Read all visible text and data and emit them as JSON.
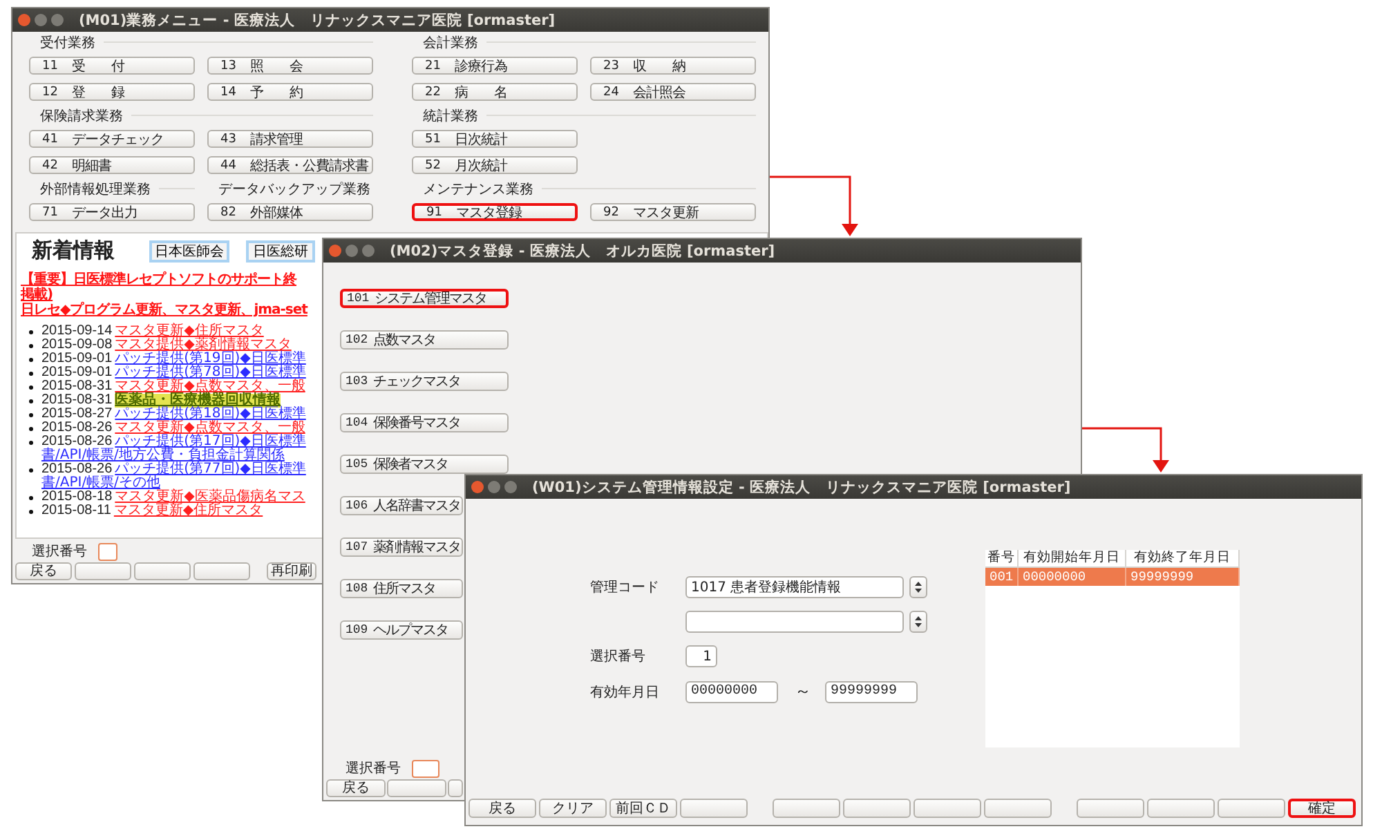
{
  "menu_window": {
    "title": "(M01)業務メニュー - 医療法人　リナックスマニア医院  [ormaster]",
    "rows": [
      {
        "kind": "headers",
        "slots": [
          "受付業務",
          "会計業務"
        ]
      },
      {
        "kind": "buttons",
        "slots": [
          {
            "number": "11",
            "label": "受　　付",
            "highlighted": false
          },
          {
            "number": "13",
            "label": "照　　会",
            "highlighted": false
          },
          {
            "number": "21",
            "label": "診療行為",
            "highlighted": false
          },
          {
            "number": "23",
            "label": "収　　納",
            "highlighted": false
          }
        ]
      },
      {
        "kind": "buttons",
        "slots": [
          {
            "number": "12",
            "label": "登　　録",
            "highlighted": false
          },
          {
            "number": "14",
            "label": "予　　約",
            "highlighted": false
          },
          {
            "number": "22",
            "label": "病　　名",
            "highlighted": false
          },
          {
            "number": "24",
            "label": "会計照会",
            "highlighted": false
          }
        ]
      },
      {
        "kind": "headers",
        "slots": [
          "保険請求業務",
          "統計業務"
        ]
      },
      {
        "kind": "buttons",
        "slots": [
          {
            "number": "41",
            "label": "データチェック",
            "highlighted": false
          },
          {
            "number": "43",
            "label": "請求管理",
            "highlighted": false
          },
          {
            "number": "51",
            "label": "日次統計",
            "highlighted": false
          }
        ]
      },
      {
        "kind": "buttons",
        "slots": [
          {
            "number": "42",
            "label": "明細書",
            "highlighted": false
          },
          {
            "number": "44",
            "label": "総括表・公費請求書",
            "highlighted": false
          },
          {
            "number": "52",
            "label": "月次統計",
            "highlighted": false
          }
        ]
      },
      {
        "kind": "headers",
        "slots": [
          "外部情報処理業務",
          "データバックアップ業務",
          "メンテナンス業務"
        ]
      },
      {
        "kind": "buttons",
        "slots": [
          {
            "number": "71",
            "label": "データ出力",
            "highlighted": false
          },
          {
            "number": "82",
            "label": "外部媒体",
            "highlighted": false
          },
          {
            "number": "91",
            "label": "マスタ登録",
            "highlighted": true
          },
          {
            "number": "92",
            "label": "マスタ更新",
            "highlighted": false
          }
        ]
      }
    ],
    "news": {
      "heading": "新着情報",
      "links": [
        "日本医師会",
        "日医総研"
      ],
      "notices": [
        "【重要】日医標準レセプトソフトのサポート終",
        "掲載)",
        "日レセ◆プログラム更新、マスタ更新、jma-set"
      ],
      "items": [
        {
          "date": "2015-09-14",
          "text": "マスタ更新◆住所マスタ",
          "color": "#ff2020",
          "highlighted": false
        },
        {
          "date": "2015-09-08",
          "text": "マスタ提供◆薬剤情報マスタ",
          "color": "#ff2020",
          "highlighted": false
        },
        {
          "date": "2015-09-01",
          "text": "パッチ提供(第19回)◆日医標準",
          "color": "#2b2bff",
          "highlighted": false
        },
        {
          "date": "2015-09-01",
          "text": "パッチ提供(第78回)◆日医標準",
          "color": "#2b2bff",
          "highlighted": false
        },
        {
          "date": "2015-08-31",
          "text": "マスタ更新◆点数マスタ、一般",
          "color": "#ff2020",
          "highlighted": false
        },
        {
          "date": "2015-08-31",
          "text": "医薬品・医療機器回収情報",
          "color": "#4d6b00",
          "highlighted": true
        },
        {
          "date": "2015-08-27",
          "text": "パッチ提供(第18回)◆日医標準",
          "color": "#2b2bff",
          "highlighted": false
        },
        {
          "date": "2015-08-26",
          "text": "マスタ更新◆点数マスタ、一般",
          "color": "#ff2020",
          "highlighted": false
        },
        {
          "date": "2015-08-26",
          "text": "パッチ提供(第17回)◆日医標準",
          "second_line": "書/API/帳票/地方公費・負担金計算関係",
          "color": "#2b2bff",
          "highlighted": false
        },
        {
          "date": "2015-08-26",
          "text": "パッチ提供(第77回)◆日医標準",
          "second_line": "書/API/帳票/その他",
          "color": "#2b2bff",
          "highlighted": false
        },
        {
          "date": "2015-08-18",
          "text": "マスタ更新◆医薬品傷病名マス",
          "color": "#ff2020",
          "highlighted": false
        },
        {
          "date": "2015-08-11",
          "text": "マスタ更新◆住所マスタ",
          "color": "#ff2020",
          "highlighted": false
        }
      ]
    },
    "selection_label": "選択番号",
    "footer_buttons": [
      {
        "kind": "labeled",
        "label": "戻る"
      },
      {
        "kind": "blank"
      },
      {
        "kind": "blank"
      },
      {
        "kind": "blank"
      },
      {
        "kind": "labeled",
        "label": "再印刷"
      }
    ]
  },
  "master_window": {
    "title": "(M02)マスタ登録 - 医療法人　オルカ医院  [ormaster]",
    "buttons": [
      {
        "number": "101",
        "label": "システム管理マスタ",
        "highlighted": true
      },
      {
        "number": "102",
        "label": "点数マスタ",
        "highlighted": false
      },
      {
        "number": "103",
        "label": "チェックマスタ",
        "highlighted": false
      },
      {
        "number": "104",
        "label": "保険番号マスタ",
        "highlighted": false
      },
      {
        "number": "105",
        "label": "保険者マスタ",
        "highlighted": false
      },
      {
        "number": "106",
        "label": "人名辞書マスタ",
        "highlighted": false
      },
      {
        "number": "107",
        "label": "薬剤情報マスタ",
        "highlighted": false
      },
      {
        "number": "108",
        "label": "住所マスタ",
        "highlighted": false
      },
      {
        "number": "109",
        "label": "ヘルプマスタ",
        "highlighted": false
      }
    ],
    "selection_label": "選択番号",
    "footer_buttons": [
      {
        "kind": "labeled",
        "label": "戻る"
      },
      {
        "kind": "blank"
      },
      {
        "kind": "blank"
      }
    ]
  },
  "settings_window": {
    "title": "(W01)システム管理情報設定 - 医療法人　リナックスマニア医院  [ormaster]",
    "code_label": "管理コード",
    "code_value": "1017 患者登録機能情報",
    "selection_label": "選択番号",
    "selection_value": "1",
    "period_label": "有効年月日",
    "period_start": "00000000",
    "period_separator": "～",
    "period_end": "99999999",
    "table": {
      "columns": [
        "番号",
        "有効開始年月日",
        "有効終了年月日"
      ],
      "rows": [
        {
          "cells": [
            "001",
            "00000000",
            "99999999"
          ],
          "selected": true
        }
      ]
    },
    "footer_buttons": [
      [
        {
          "label": "戻る",
          "highlighted": false
        },
        {
          "label": "クリア",
          "highlighted": false
        },
        {
          "label": "前回ＣＤ",
          "highlighted": false
        },
        {
          "highlighted": false
        }
      ],
      [
        {
          "highlighted": false
        },
        {
          "highlighted": false
        },
        {
          "highlighted": false
        },
        {
          "highlighted": false
        }
      ],
      [
        {
          "highlighted": false
        },
        {
          "highlighted": false
        },
        {
          "highlighted": false
        },
        {
          "label": "確定",
          "highlighted": true
        }
      ]
    ]
  }
}
